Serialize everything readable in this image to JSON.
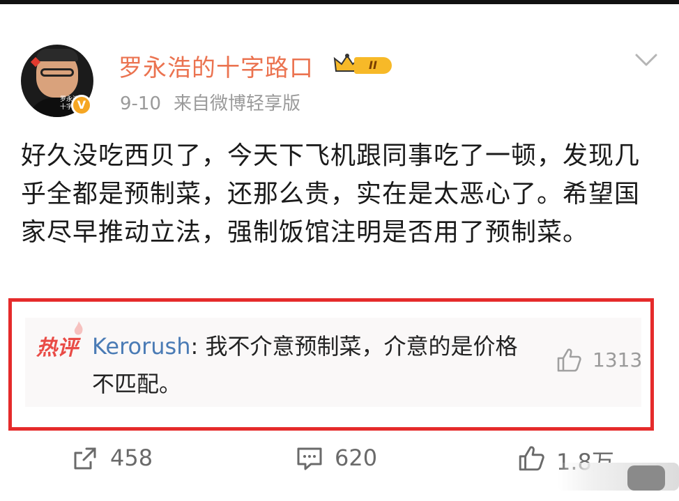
{
  "author": {
    "name": "罗永浩的十字路口",
    "level_badge": "II",
    "verified_badge": "V",
    "avatar_caption": "罗永浩的十字路口"
  },
  "meta": {
    "date": "9-10",
    "source": "来自微博轻享版"
  },
  "post": {
    "text": "好久没吃西贝了，今天下飞机跟同事吃了一顿，发现几乎全都是预制菜，还那么贵，实在是太恶心了。希望国家尽早推动立法，强制饭馆注明是否用了预制菜。"
  },
  "hot_comment": {
    "label": "热评",
    "author": "Kerorush",
    "separator": ": ",
    "text": "我不介意预制菜，介意的是价格不匹配。",
    "likes": "1313"
  },
  "actions": {
    "reposts": "458",
    "comments": "620",
    "likes": "1.8万"
  },
  "colors": {
    "username": "#eb7350",
    "highlight_border": "#e52b2b",
    "comment_author": "#4a7bb5",
    "hot_label": "#e94b46"
  },
  "icons": [
    "verified-v-icon",
    "crown-level-icon",
    "chevron-down-icon",
    "flame-icon",
    "thumbs-up-icon",
    "repost-icon",
    "comment-icon"
  ]
}
